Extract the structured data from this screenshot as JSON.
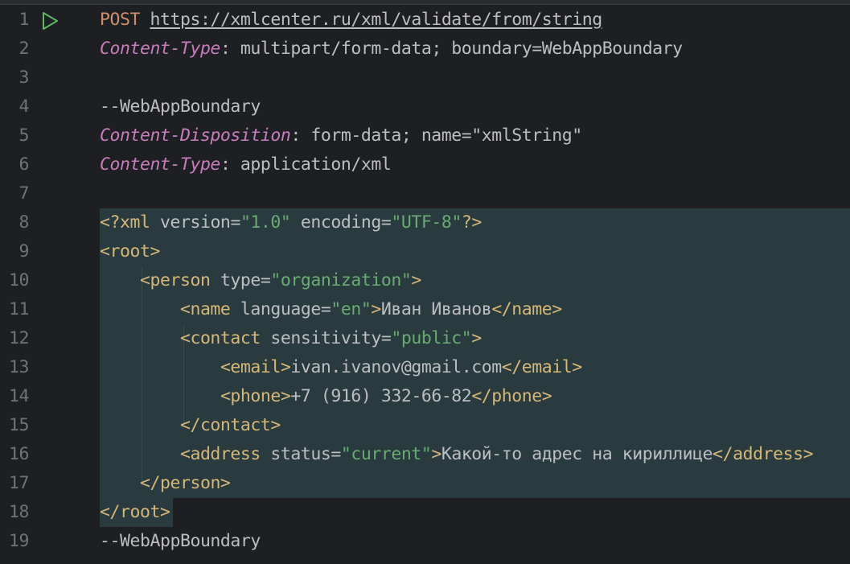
{
  "lines": [
    {
      "num": "1",
      "parts": [
        {
          "t": "POST",
          "c": "kw"
        },
        {
          "t": " ",
          "c": "txt"
        },
        {
          "t": "https://xmlcenter.ru/xml/validate/from/string",
          "c": "url"
        }
      ]
    },
    {
      "num": "2",
      "parts": [
        {
          "t": "Content-Type",
          "c": "hdr"
        },
        {
          "t": ": multipart/form-data; boundary=WebAppBoundary",
          "c": "txt"
        }
      ]
    },
    {
      "num": "3",
      "parts": []
    },
    {
      "num": "4",
      "parts": [
        {
          "t": "--WebAppBoundary",
          "c": "txt"
        }
      ]
    },
    {
      "num": "5",
      "parts": [
        {
          "t": "Content-Disposition",
          "c": "hdr"
        },
        {
          "t": ": form-data; name=\"xmlString\"",
          "c": "txt"
        }
      ]
    },
    {
      "num": "6",
      "parts": [
        {
          "t": "Content-Type",
          "c": "hdr"
        },
        {
          "t": ": application/xml",
          "c": "txt"
        }
      ]
    },
    {
      "num": "7",
      "parts": []
    },
    {
      "num": "8",
      "parts": [
        {
          "t": "<?xml ",
          "c": "tag"
        },
        {
          "t": "version",
          "c": "attr"
        },
        {
          "t": "=",
          "c": "txt"
        },
        {
          "t": "\"1.0\"",
          "c": "val"
        },
        {
          "t": " ",
          "c": "txt"
        },
        {
          "t": "encoding",
          "c": "attr"
        },
        {
          "t": "=",
          "c": "txt"
        },
        {
          "t": "\"UTF-8\"",
          "c": "val"
        },
        {
          "t": "?>",
          "c": "tag"
        }
      ]
    },
    {
      "num": "9",
      "parts": [
        {
          "t": "<root>",
          "c": "tag"
        }
      ]
    },
    {
      "num": "10",
      "parts": [
        {
          "t": "    ",
          "c": "txt"
        },
        {
          "t": "<person ",
          "c": "tag"
        },
        {
          "t": "type",
          "c": "attr"
        },
        {
          "t": "=",
          "c": "txt"
        },
        {
          "t": "\"organization\"",
          "c": "val"
        },
        {
          "t": ">",
          "c": "tag"
        }
      ]
    },
    {
      "num": "11",
      "parts": [
        {
          "t": "        ",
          "c": "txt"
        },
        {
          "t": "<name ",
          "c": "tag"
        },
        {
          "t": "language",
          "c": "attr"
        },
        {
          "t": "=",
          "c": "txt"
        },
        {
          "t": "\"en\"",
          "c": "val"
        },
        {
          "t": ">",
          "c": "tag"
        },
        {
          "t": "Иван Иванов",
          "c": "txt"
        },
        {
          "t": "</name>",
          "c": "tag"
        }
      ]
    },
    {
      "num": "12",
      "parts": [
        {
          "t": "        ",
          "c": "txt"
        },
        {
          "t": "<contact ",
          "c": "tag"
        },
        {
          "t": "sensitivity",
          "c": "attr"
        },
        {
          "t": "=",
          "c": "txt"
        },
        {
          "t": "\"public\"",
          "c": "val"
        },
        {
          "t": ">",
          "c": "tag"
        }
      ]
    },
    {
      "num": "13",
      "parts": [
        {
          "t": "            ",
          "c": "txt"
        },
        {
          "t": "<email>",
          "c": "tag"
        },
        {
          "t": "ivan.ivanov@gmail.com",
          "c": "txt"
        },
        {
          "t": "</email>",
          "c": "tag"
        }
      ]
    },
    {
      "num": "14",
      "parts": [
        {
          "t": "            ",
          "c": "txt"
        },
        {
          "t": "<phone>",
          "c": "tag"
        },
        {
          "t": "+7 (916) 332-66-82",
          "c": "txt"
        },
        {
          "t": "</phone>",
          "c": "tag"
        }
      ]
    },
    {
      "num": "15",
      "parts": [
        {
          "t": "        ",
          "c": "txt"
        },
        {
          "t": "</contact>",
          "c": "tag"
        }
      ]
    },
    {
      "num": "16",
      "parts": [
        {
          "t": "        ",
          "c": "txt"
        },
        {
          "t": "<address ",
          "c": "tag"
        },
        {
          "t": "status",
          "c": "attr"
        },
        {
          "t": "=",
          "c": "txt"
        },
        {
          "t": "\"current\"",
          "c": "val"
        },
        {
          "t": ">",
          "c": "tag"
        },
        {
          "t": "Какой-то адрес на кириллице",
          "c": "txt"
        },
        {
          "t": "</address>",
          "c": "tag"
        }
      ]
    },
    {
      "num": "17",
      "parts": [
        {
          "t": "    ",
          "c": "txt"
        },
        {
          "t": "</person>",
          "c": "tag"
        }
      ]
    },
    {
      "num": "18",
      "parts": [
        {
          "t": "</root>",
          "c": "tag"
        }
      ]
    },
    {
      "num": "19",
      "parts": [
        {
          "t": "--WebAppBoundary",
          "c": "txt"
        }
      ]
    }
  ],
  "gutter": {
    "run_icon": "run-request-icon"
  },
  "colors": {
    "background": "#1e1f22",
    "injected_highlight": "#293b3f",
    "keyword": "#cf8e6d",
    "header": "#c77dbb",
    "tag": "#d5b778",
    "string": "#6aab73",
    "text": "#bcbec4",
    "line_number": "#6f737a",
    "run_icon": "#5fb865"
  }
}
